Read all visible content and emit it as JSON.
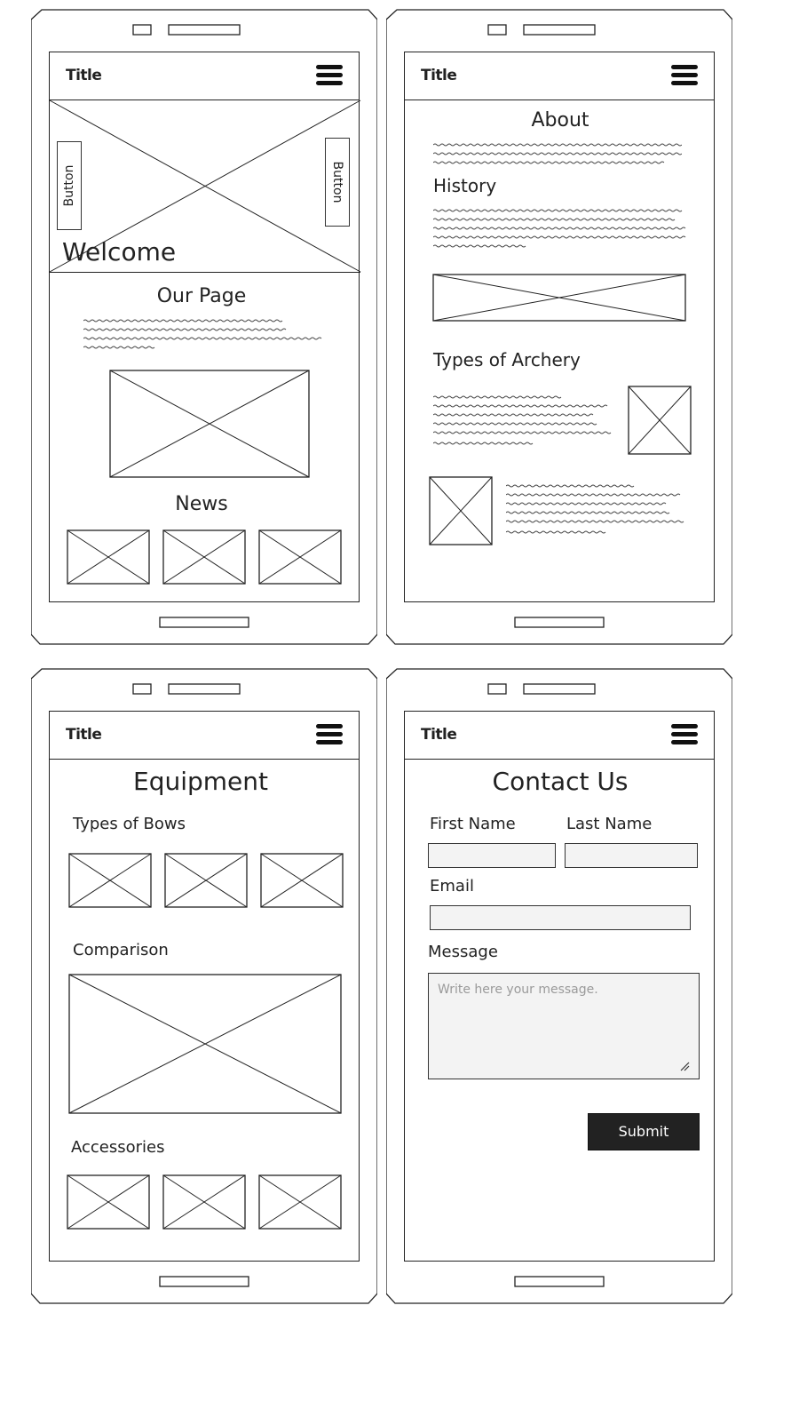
{
  "app_title": "Title",
  "home": {
    "button_left": "Button",
    "button_right": "Button",
    "hero_title": "Welcome",
    "section_title": "Our Page",
    "news_title": "News"
  },
  "about": {
    "title": "About",
    "history_title": "History",
    "types_title": "Types of Archery"
  },
  "equipment": {
    "title": "Equipment",
    "bows_title": "Types of Bows",
    "comparison_title": "Comparison",
    "accessories_title": "Accessories"
  },
  "contact": {
    "title": "Contact Us",
    "first_name_label": "First Name",
    "last_name_label": "Last Name",
    "email_label": "Email",
    "message_label": "Message",
    "message_placeholder": "Write here your message.",
    "submit_label": "Submit"
  },
  "icons": {
    "menu": "hamburger-menu-icon",
    "image": "image-placeholder-icon",
    "resize": "resize-grip-icon"
  },
  "colors": {
    "stroke": "#222222",
    "input_fill": "#f3f3f3",
    "button_fill": "#222222"
  }
}
